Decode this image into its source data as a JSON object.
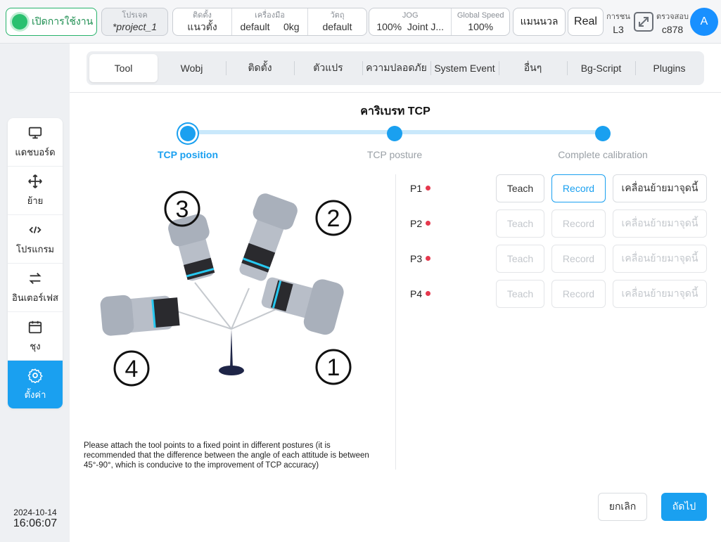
{
  "topbar": {
    "power_label": "เปิดการใช้งาน",
    "project": {
      "caption": "โปรเจค",
      "value": "*project_1"
    },
    "install": {
      "caption": "ติดตั้ง",
      "value": "แนวตั้ง"
    },
    "tool": {
      "caption": "เครื่องมือ",
      "value": "default",
      "load": "0kg"
    },
    "wobj": {
      "caption": "วัตถุ",
      "value": "default"
    },
    "jog": {
      "caption": "JOG",
      "speed": "100%",
      "mode": "Joint J..."
    },
    "global_speed": {
      "caption": "Global Speed",
      "value": "100%"
    },
    "manual_label": "แมนนวล",
    "real_label": "Real",
    "collision": {
      "caption": "การชน",
      "value": "L3"
    },
    "check": {
      "caption": "ตรวจสอบ",
      "value": "c878"
    },
    "avatar_letter": "A"
  },
  "sidebar": {
    "items": [
      {
        "label": "แดชบอร์ด",
        "icon": "monitor-icon"
      },
      {
        "label": "ย้าย",
        "icon": "move-icon"
      },
      {
        "label": "โปรแกรม",
        "icon": "code-icon"
      },
      {
        "label": "อินเตอร์เฟส",
        "icon": "swap-icon"
      },
      {
        "label": "ชุง",
        "icon": "calendar-icon"
      },
      {
        "label": "ตั้งค่า",
        "icon": "gear-icon"
      }
    ]
  },
  "clock": {
    "date": "2024-10-14",
    "time": "16:06:07"
  },
  "tabs": [
    {
      "label": "Tool"
    },
    {
      "label": "Wobj"
    },
    {
      "label": "ติดตั้ง"
    },
    {
      "label": "ตัวแปร"
    },
    {
      "label": "ความปลอดภัย"
    },
    {
      "label": "System Event"
    },
    {
      "label": "อื่นๆ"
    },
    {
      "label": "Bg-Script"
    },
    {
      "label": "Plugins"
    }
  ],
  "calibration": {
    "title": "คาริเบรท TCP",
    "steps": [
      "TCP position",
      "TCP posture",
      "Complete calibration"
    ],
    "hint": "Please attach the tool points to a fixed point in different postures (it is recommended that the difference between the angle of each attitude is between 45°-90°, which is conducive to the improvement of TCP accuracy)",
    "illustration_numbers": [
      "1",
      "2",
      "3",
      "4"
    ],
    "teach_label": "Teach",
    "record_label": "Record",
    "move_label": "เคลื่อนย้ายมาจุดนี้",
    "points": [
      {
        "label": "P1",
        "enabled": true
      },
      {
        "label": "P2",
        "enabled": false
      },
      {
        "label": "P3",
        "enabled": false
      },
      {
        "label": "P4",
        "enabled": false
      }
    ],
    "point_status_color": "#e5384d"
  },
  "footer": {
    "cancel_label": "ยกเลิก",
    "next_label": "ถัดไป"
  },
  "colors": {
    "accent": "#1aa0f0",
    "power_green": "#2ac06f"
  }
}
